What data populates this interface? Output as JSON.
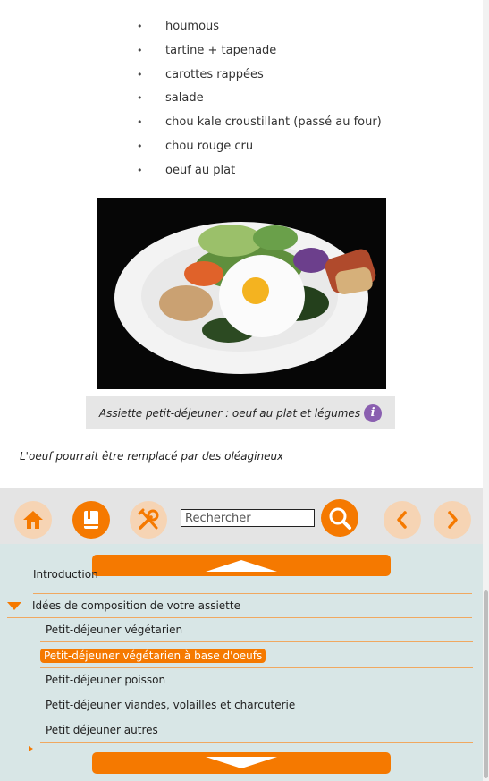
{
  "ingredients": [
    "houmous",
    "tartine + tapenade",
    "carottes rappées",
    "salade",
    "chou kale croustillant (passé au four)",
    "chou rouge cru",
    "oeuf au plat"
  ],
  "figure": {
    "caption": "Assiette petit-déjeuner : oeuf au plat et légumes",
    "info_icon": "info-icon"
  },
  "note": "L'oeuf pourrait être remplacé par des oléagineux",
  "toolbar": {
    "home_icon": "home-icon",
    "book_icon": "book-icon",
    "tools_icon": "tools-icon",
    "search_placeholder": "Rechercher",
    "search_icon": "search-icon",
    "prev_icon": "chevron-left-icon",
    "next_icon": "chevron-right-icon"
  },
  "toc": {
    "top_partial": "Introduction",
    "section": "Idées de composition de votre assiette",
    "items": [
      {
        "label": "Petit-déjeuner végétarien",
        "active": false
      },
      {
        "label": "Petit-déjeuner végétarien à base d'oeufs",
        "active": true
      },
      {
        "label": "Petit-déjeuner poisson",
        "active": false
      },
      {
        "label": "Petit-déjeuner viandes, volailles et charcuterie",
        "active": false
      },
      {
        "label": "Petit déjeuner autres",
        "active": false
      }
    ]
  },
  "colors": {
    "accent": "#f57900",
    "toc_bg": "#d8e6e6",
    "toolbar_bg": "#e4e4e4",
    "info": "#8a5fb0"
  }
}
